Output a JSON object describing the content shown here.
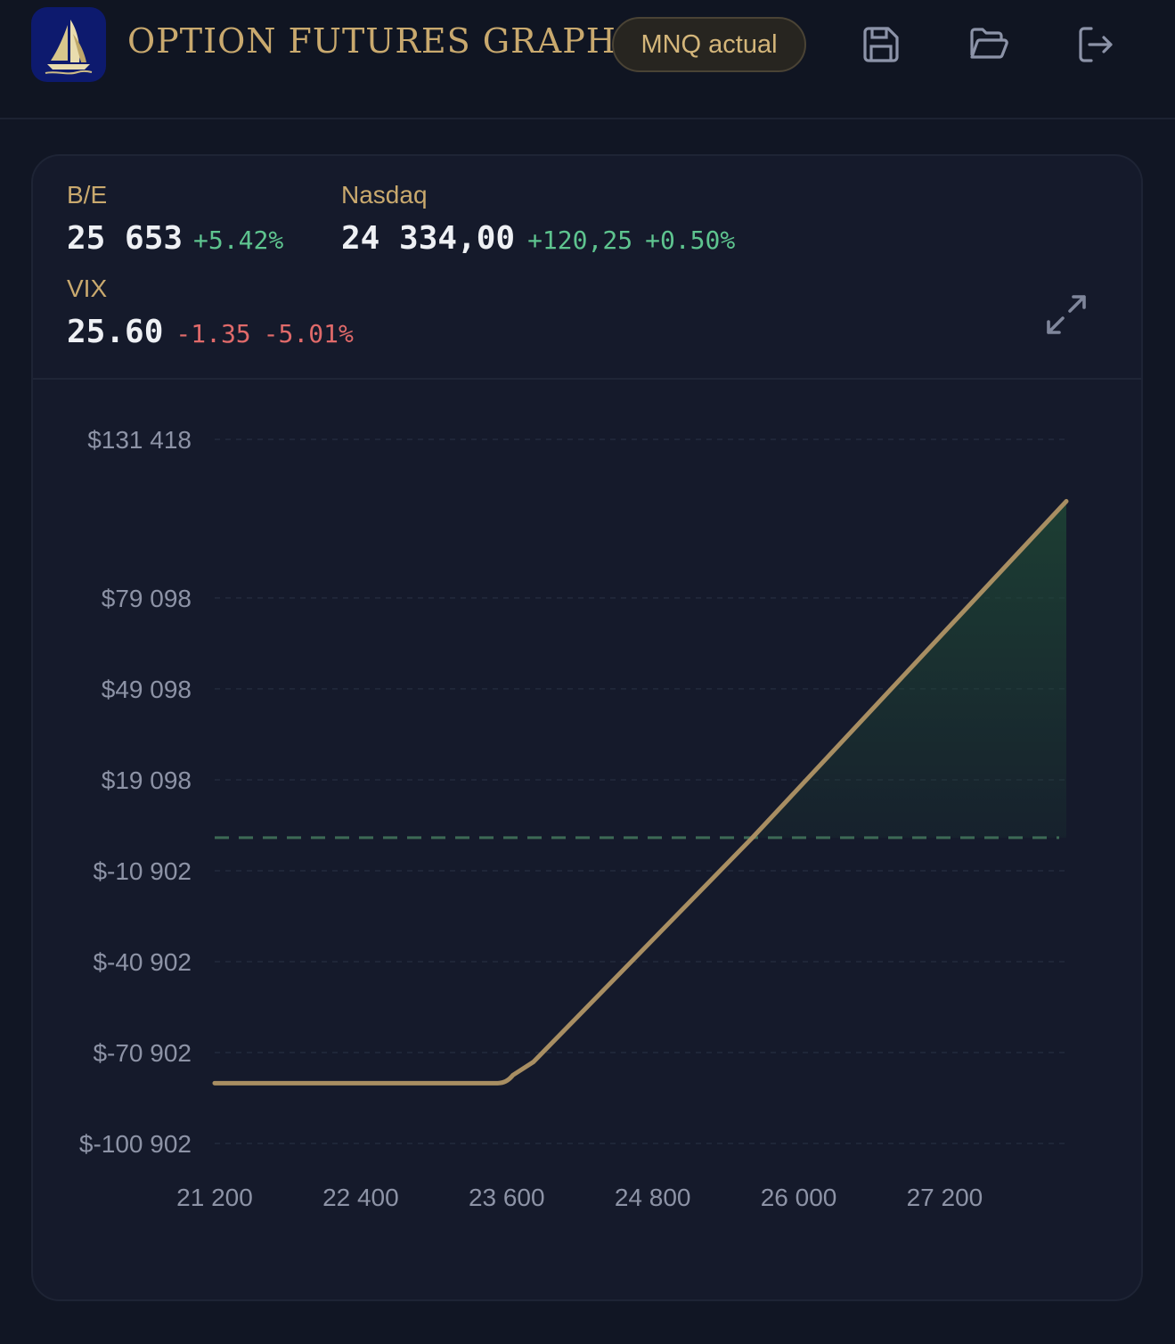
{
  "header": {
    "title": "OPTION FUTURES GRAPH",
    "badge": "MNQ actual",
    "icons": [
      "save-icon",
      "folder-open-icon",
      "logout-icon"
    ]
  },
  "stats": {
    "be": {
      "label": "B/E",
      "value": "25 653",
      "change_pct": "+5.42%"
    },
    "nasdaq": {
      "label": "Nasdaq",
      "value": "24 334,00",
      "change": "+120,25",
      "change_pct": "+0.50%"
    },
    "vix": {
      "label": "VIX",
      "value": "25.60",
      "change": "-1.35",
      "change_pct": "-5.01%"
    }
  },
  "colors": {
    "accent": "#c9a96e",
    "positive": "#5ec48f",
    "negative": "#e06a6a",
    "background": "#111624",
    "card": "#151a2b"
  },
  "chart_data": {
    "type": "line",
    "y_tick_labels": [
      "$131 418",
      "$79 098",
      "$49 098",
      "$19 098",
      "$-10 902",
      "$-40 902",
      "$-70 902",
      "$-100 902"
    ],
    "y_ticks": [
      131418,
      79098,
      49098,
      19098,
      -10902,
      -40902,
      -70902,
      -100902
    ],
    "x_tick_labels": [
      "21 200",
      "22 400",
      "23 600",
      "24 800",
      "26 000",
      "27 200"
    ],
    "x_ticks": [
      21200,
      22400,
      23600,
      24800,
      26000,
      27200
    ],
    "ylim": [
      -100902,
      131418
    ],
    "xlim": [
      21200,
      28200
    ],
    "series": [
      {
        "x": [
          21200,
          23600,
          23820,
          25620,
          28200
        ],
        "y": [
          -81000,
          -81000,
          -74000,
          0,
          111000
        ]
      }
    ],
    "zero_line": 0,
    "grid": true,
    "fill_positive": true
  }
}
